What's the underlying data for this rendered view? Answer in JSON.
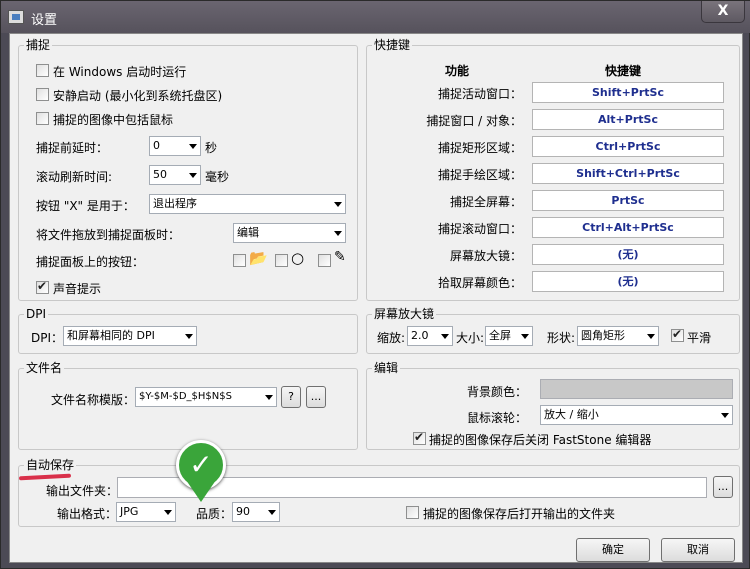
{
  "window": {
    "title": "设置",
    "close_label": "X"
  },
  "capture": {
    "group": "捕捉",
    "run_at_startup": "在 Windows 启动时运行",
    "quiet_start": "安静启动 (最小化到系统托盘区)",
    "include_cursor": "捕捉的图像中包括鼠标",
    "delay_label": "捕捉前延时：",
    "delay_value": "0",
    "delay_unit": "秒",
    "scroll_label": "滚动刷新时间:",
    "scroll_value": "50",
    "scroll_unit": "毫秒",
    "x_label": "按钮 \"X\" 是用于：",
    "x_value": "退出程序",
    "drag_label": "将文件拖放到捕捉面板时：",
    "drag_value": "编辑",
    "panel_buttons_label": "捕捉面板上的按钮：",
    "sound_label": "声音提示"
  },
  "hotkeys": {
    "group": "快捷键",
    "col_function": "功能",
    "col_hotkey": "快捷键",
    "rows": [
      {
        "f": "捕捉活动窗口：",
        "k": "Shift+PrtSc"
      },
      {
        "f": "捕捉窗口 / 对象：",
        "k": "Alt+PrtSc"
      },
      {
        "f": "捕捉矩形区域：",
        "k": "Ctrl+PrtSc"
      },
      {
        "f": "捕捉手绘区域：",
        "k": "Shift+Ctrl+PrtSc"
      },
      {
        "f": "捕捉全屏幕：",
        "k": "PrtSc"
      },
      {
        "f": "捕捉滚动窗口：",
        "k": "Ctrl+Alt+PrtSc"
      },
      {
        "f": "屏幕放大镜：",
        "k": "(无)"
      },
      {
        "f": "拾取屏幕颜色：",
        "k": "(无)"
      }
    ]
  },
  "dpi": {
    "group": "DPI",
    "label": "DPI：",
    "value": "和屏幕相同的 DPI"
  },
  "magnifier": {
    "group": "屏幕放大镜",
    "zoom_label": "缩放:",
    "zoom_value": "2.0",
    "size_label": "大小:",
    "size_value": "全屏",
    "shape_label": "形状:",
    "shape_value": "圆角矩形",
    "smooth_label": "平滑"
  },
  "filename": {
    "group": "文件名",
    "template_label": "文件名称模版：",
    "template_value": "$Y-$M-$D_$H$N$S",
    "help_label": "?",
    "more_label": "..."
  },
  "edit": {
    "group": "编辑",
    "bg_label": "背景颜色：",
    "wheel_label": "鼠标滚轮：",
    "wheel_value": "放大 / 缩小",
    "close_label": "捕捉的图像保存后关闭 FastStone 编辑器"
  },
  "autosave": {
    "group": "自动保存",
    "folder_label": "输出文件夹：",
    "folder_value": "",
    "browse_label": "...",
    "format_label": "输出格式：",
    "format_value": "JPG",
    "quality_label": "品质：",
    "quality_value": "90",
    "open_folder_label": "捕捉的图像保存后打开输出的文件夹"
  },
  "footer": {
    "ok_label": "确定",
    "cancel_label": "取消"
  },
  "colors": {
    "frame": "#4c4a55",
    "client": "#f0f0f0",
    "hotkey_text": "#1f2f8f",
    "annotation_green": "#3aa53a",
    "annotation_red": "#d9304a"
  }
}
